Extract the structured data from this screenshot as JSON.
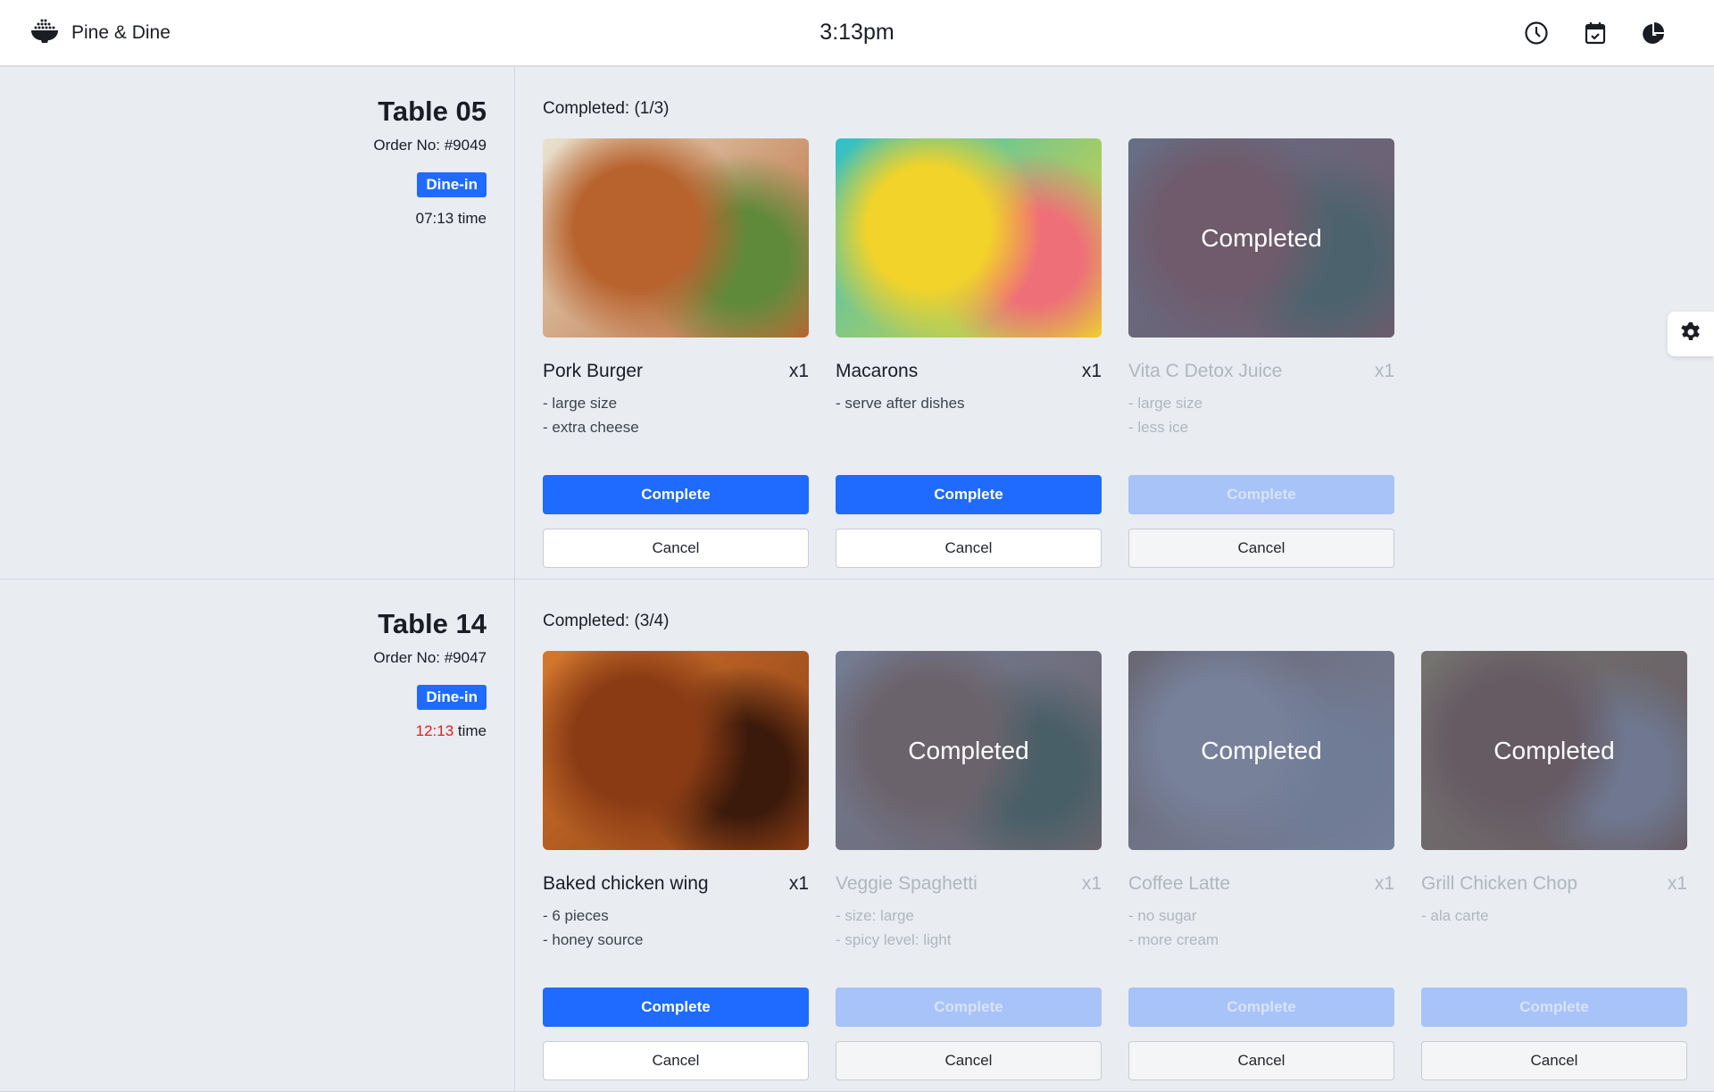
{
  "header": {
    "brand": "Pine & Dine",
    "clock": "3:13pm"
  },
  "orders": [
    {
      "table": "Table 05",
      "order_no": "Order No: #9049",
      "type": "Dine-in",
      "time_value": "07:13",
      "time_suffix": " time",
      "late": false,
      "completed": "Completed: (1/3)",
      "items": [
        {
          "name": "Pork Burger",
          "qty": "x1",
          "notes": [
            "- large size",
            "- extra cheese"
          ],
          "done": false,
          "image": "grilled-pork",
          "colors": [
            "#b8632e",
            "#e9e2cf",
            "#5f8a3a"
          ]
        },
        {
          "name": "Macarons",
          "qty": "x1",
          "notes": [
            "- serve after dishes"
          ],
          "done": false,
          "image": "macarons",
          "colors": [
            "#f2d329",
            "#2fc0c8",
            "#ef6f78"
          ]
        },
        {
          "name": "Vita C Detox Juice",
          "qty": "x1",
          "notes": [
            "- large size",
            "- less ice"
          ],
          "done": true,
          "image": "juice",
          "colors": [
            "#d86b4a",
            "#b9b3a8",
            "#5c8a50"
          ]
        }
      ]
    },
    {
      "table": "Table 14",
      "order_no": "Order No: #9047",
      "type": "Dine-in",
      "time_value": "12:13",
      "time_suffix": " time",
      "late": true,
      "completed": "Completed: (3/4)",
      "items": [
        {
          "name": "Baked chicken wing",
          "qty": "x1",
          "notes": [
            "- 6 pieces",
            "- honey source"
          ],
          "done": false,
          "image": "chicken-wings",
          "colors": [
            "#8a3b14",
            "#d4782e",
            "#3c1a0b"
          ]
        },
        {
          "name": "Veggie Spaghetti",
          "qty": "x1",
          "notes": [
            "- size: large",
            "- spicy level: light"
          ],
          "done": true,
          "image": "spaghetti",
          "colors": [
            "#c9894a",
            "#e9e6df",
            "#4f7a3a"
          ]
        },
        {
          "name": "Coffee Latte",
          "qty": "x1",
          "notes": [
            "- no sugar",
            "- more cream"
          ],
          "done": true,
          "image": "latte",
          "colors": [
            "#f2f2f0",
            "#c59a6a",
            "#d9dde2"
          ]
        },
        {
          "name": "Grill Chicken Chop",
          "qty": "x1",
          "notes": [
            "- ala carte"
          ],
          "done": true,
          "image": "chicken-chop",
          "colors": [
            "#b86a2e",
            "#e7c45a",
            "#d6d4cc"
          ]
        }
      ]
    }
  ],
  "labels": {
    "complete": "Complete",
    "cancel": "Cancel",
    "completed_overlay": "Completed"
  }
}
